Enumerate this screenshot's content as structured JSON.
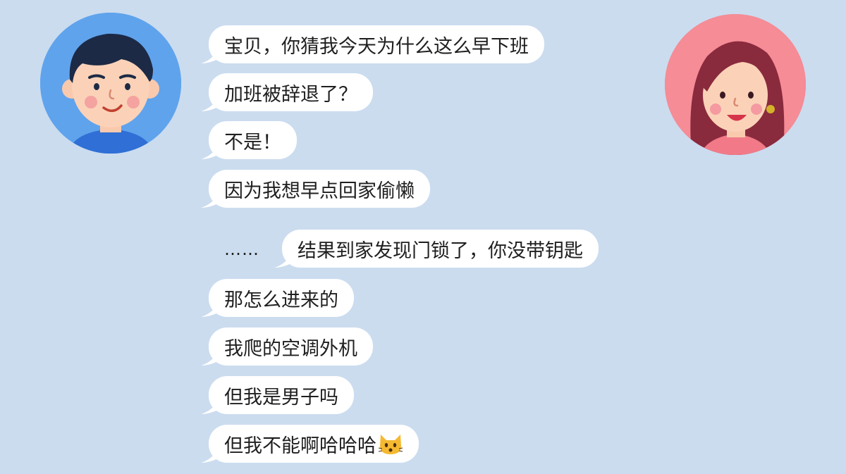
{
  "chat": {
    "messages": [
      {
        "text": "宝贝，你猜我今天为什么这么早下班",
        "side": "left"
      },
      {
        "text": "加班被辞退了？",
        "side": "left"
      },
      {
        "text": "不是！",
        "side": "left"
      },
      {
        "text": "因为我想早点回家偷懒",
        "side": "left"
      },
      {
        "text": "结果到家发现门锁了，你没带钥匙",
        "side": "right"
      },
      {
        "text": "那怎么进来的",
        "side": "left"
      },
      {
        "text": "我爬的空调外机",
        "side": "left"
      },
      {
        "text": "但我是男子吗",
        "side": "left"
      },
      {
        "text": "但我不能啊哈哈哈",
        "side": "left"
      }
    ],
    "ellipsis": "……",
    "last_emoji": "cat-face-emoji"
  },
  "colors": {
    "background": "#cbdcef",
    "bubble": "#ffffff",
    "avatar_left_bg": "#5fa3ec",
    "avatar_right_bg": "#f58c96"
  }
}
